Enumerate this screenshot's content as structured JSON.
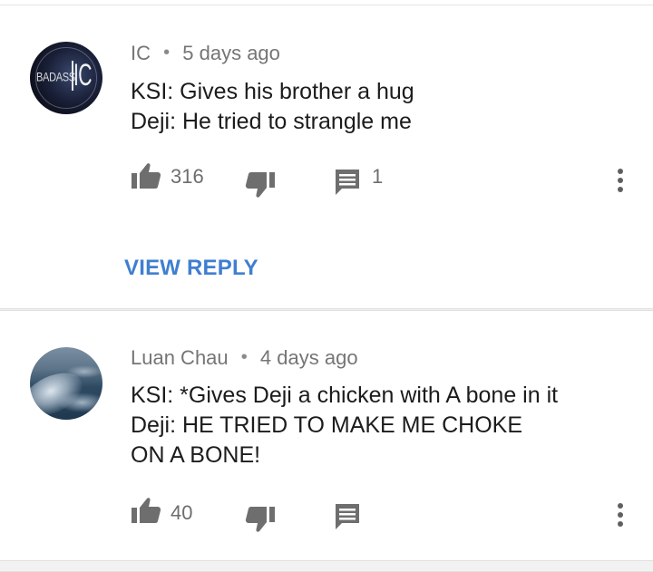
{
  "comments": [
    {
      "author": "IC",
      "separator": "•",
      "time": "5 days ago",
      "avatar": {
        "type": "logo",
        "text_small": "BADASS",
        "text_big": "IC"
      },
      "lines": [
        "KSI: Gives his brother a hug",
        "Deji: He tried to strangle me"
      ],
      "likes": "316",
      "replies": "1",
      "view_reply_label": "VIEW REPLY"
    },
    {
      "author": "Luan Chau",
      "separator": "•",
      "time": "4 days ago",
      "avatar": {
        "type": "photo-sea"
      },
      "lines": [
        "KSI: *Gives Deji a chicken with A bone in it",
        "Deji: HE TRIED TO MAKE ME CHOKE",
        "ON A BONE!"
      ],
      "likes": "40",
      "replies": ""
    }
  ],
  "icons": {
    "like": "thumb-up-icon",
    "dislike": "thumb-down-icon",
    "reply": "comment-icon",
    "more": "more-vert-icon"
  },
  "colors": {
    "link_blue": "#3f7fd0",
    "meta_gray": "#757575",
    "text_dark": "#1c1c1c",
    "icon_gray": "#6e6e6e"
  }
}
